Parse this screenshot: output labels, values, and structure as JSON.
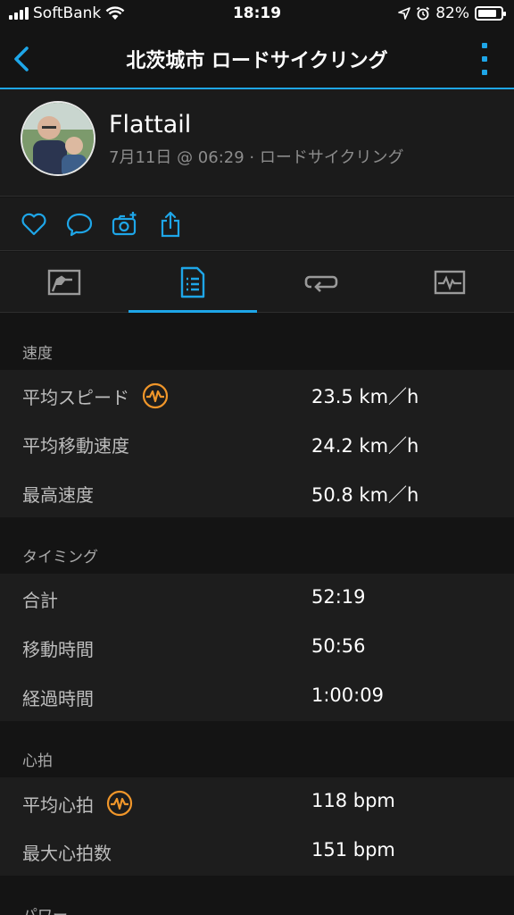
{
  "status_bar": {
    "carrier": "SoftBank",
    "time": "18:19",
    "battery": "82%",
    "battery_level": 0.82
  },
  "nav": {
    "title": "北茨城市 ロードサイクリング"
  },
  "profile": {
    "name": "Flattail",
    "meta": "7月11日 @ 06:29 · ロードサイクリング"
  },
  "tabs": [
    {
      "icon": "chart-icon",
      "active": false
    },
    {
      "icon": "list-document-icon",
      "active": true
    },
    {
      "icon": "laps-icon",
      "active": false
    },
    {
      "icon": "graph-icon",
      "active": false
    }
  ],
  "sections": [
    {
      "title": "速度",
      "rows": [
        {
          "label": "平均スピード",
          "value": "23.5 km／h",
          "icon": "heart-rate-icon"
        },
        {
          "label": "平均移動速度",
          "value": "24.2 km／h"
        },
        {
          "label": "最高速度",
          "value": "50.8 km／h"
        }
      ]
    },
    {
      "title": "タイミング",
      "rows": [
        {
          "label": "合計",
          "value": "52:19"
        },
        {
          "label": "移動時間",
          "value": "50:56"
        },
        {
          "label": "経過時間",
          "value": "1:00:09"
        }
      ]
    },
    {
      "title": "心拍",
      "rows": [
        {
          "label": "平均心拍",
          "value": "118 bpm",
          "icon": "heart-rate-icon"
        },
        {
          "label": "最大心拍数",
          "value": "151 bpm"
        }
      ]
    },
    {
      "title": "パワー",
      "rows": []
    }
  ],
  "colors": {
    "accent": "#1ea6e8",
    "badge": "#f0962a",
    "background": "#141414",
    "row_background": "#1d1d1d"
  }
}
